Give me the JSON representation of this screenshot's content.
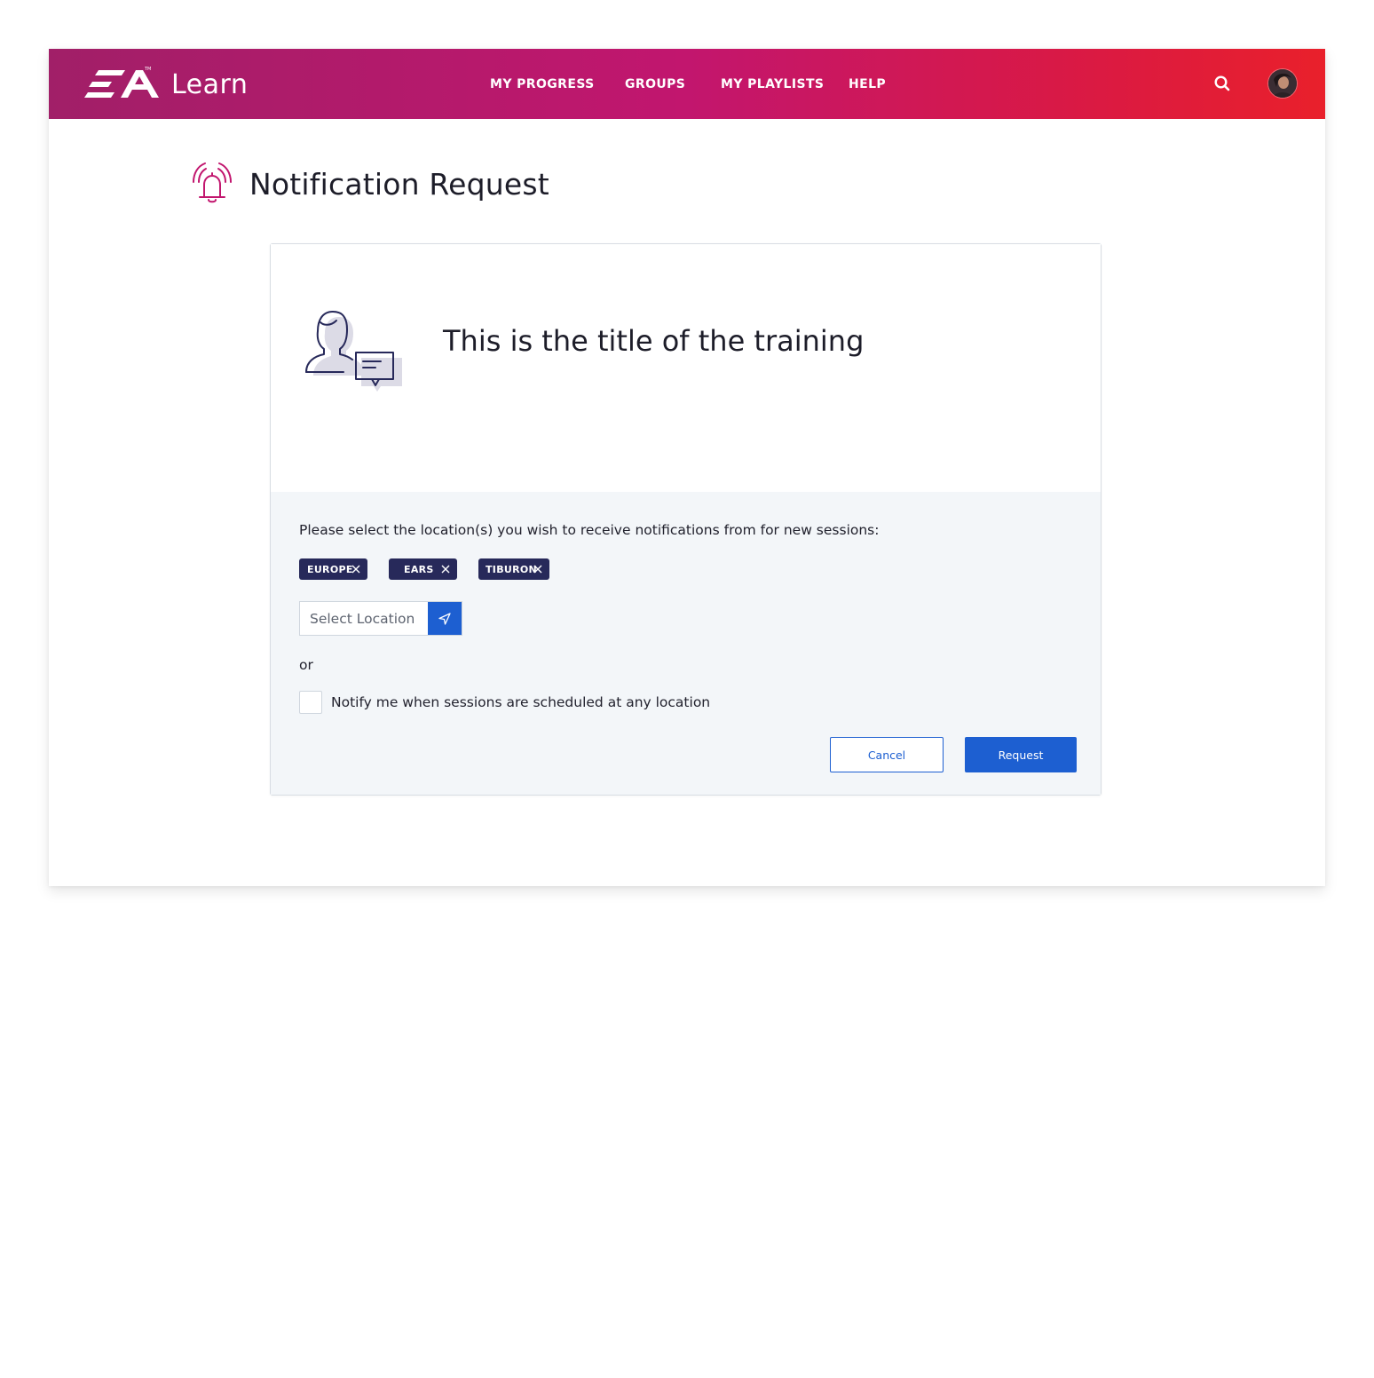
{
  "app": {
    "brand": "EA",
    "product_name": "Learn",
    "accent_color": "#c2166e",
    "primary_button_color": "#1d5fd1",
    "chip_color": "#27295a"
  },
  "nav": {
    "items": [
      {
        "label": "MY PROGRESS"
      },
      {
        "label": "GROUPS"
      },
      {
        "label": "MY PLAYLISTS"
      },
      {
        "label": "HELP"
      }
    ],
    "search_icon": "search-icon",
    "avatar": "user-avatar"
  },
  "page": {
    "title": "Notification Request",
    "title_icon": "bell-ringing-icon"
  },
  "training": {
    "title": "This is the title of the training",
    "illustration": "person-with-chat-bubble-icon"
  },
  "form": {
    "prompt": "Please select the location(s) you wish to receive notifications from for new sessions:",
    "selected_locations": [
      {
        "label": "EUROPE"
      },
      {
        "label": "EARS"
      },
      {
        "label": "TIBURON"
      }
    ],
    "location_input": {
      "value": "",
      "placeholder": "Select Location",
      "button_icon": "location-arrow-icon"
    },
    "or_text": "or",
    "any_location_checkbox": {
      "label": "Notify me when sessions are scheduled at any location",
      "checked": false
    },
    "cancel_label": "Cancel",
    "request_label": "Request"
  }
}
